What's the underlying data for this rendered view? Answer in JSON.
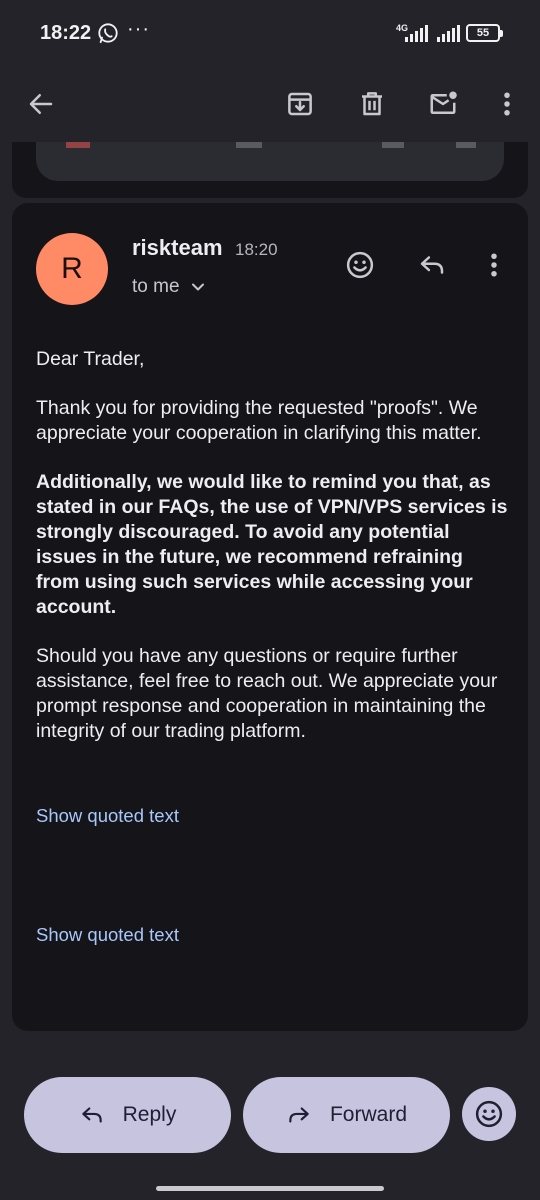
{
  "status_bar": {
    "time": "18:22",
    "overflow": "···",
    "network": "4G",
    "battery": "55"
  },
  "message": {
    "avatar_letter": "R",
    "avatar_color": "#ff8a65",
    "sender": "riskteam",
    "time": "18:20",
    "recipient": "to me",
    "body": {
      "greeting": "Dear Trader,",
      "p1": "Thank you for providing the requested \"proofs\". We appreciate your cooperation in clarifying this matter.",
      "p2": "Additionally, we would like to remind you that, as stated in our FAQs, the use of VPN/VPS services is strongly discouraged. To avoid any potential issues in the future, we recommend refraining from using such services while accessing your account.",
      "p3": "Should you have any questions or require further assistance, feel free to reach out. We appreciate your prompt response and cooperation in maintaining the integrity of our trading platform."
    },
    "show_quoted_1": "Show quoted text",
    "show_quoted_2": "Show quoted text"
  },
  "actions": {
    "reply_label": "Reply",
    "forward_label": "Forward"
  },
  "colors": {
    "background": "#232329",
    "card": "#141419",
    "link": "#a8c7fa",
    "pill": "#c7c4e0"
  }
}
